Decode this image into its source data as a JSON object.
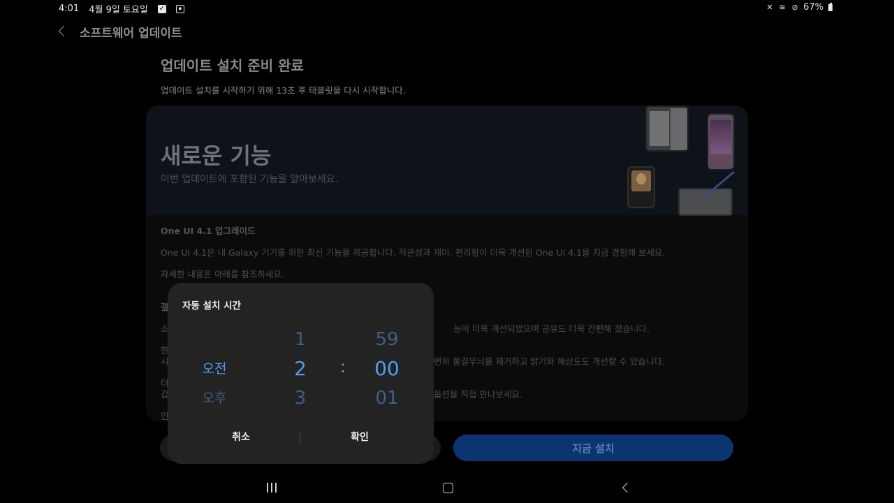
{
  "status_bar": {
    "time": "4:01",
    "date": "4월 9일 토요일",
    "battery": "67%",
    "icons": [
      "check-icon",
      "screenshot-icon",
      "mute-icon",
      "wifi-icon",
      "block-icon",
      "battery-icon"
    ]
  },
  "header": {
    "title": "소프트웨어 업데이트"
  },
  "update": {
    "title": "업데이트 설치 준비 완료",
    "description": "업데이트 설치를 시작하기 위해 13초 후 태블릿을 다시 시작합니다."
  },
  "banner": {
    "title": "새로운 기능",
    "subtitle": "이번 업데이트에 포함된 기능을 알아보세요."
  },
  "notes": {
    "heading": "One UI 4.1 업그레이드",
    "intro": "One UI 4.1은 내 Galaxy 기기를 위한 최신 기능을 제공합니다. 직관성과 재미, 편리함이 더욱 개선된 One UI 4.1을 지금 경험해 보세요.",
    "more": "자세한 내용은 아래를 참조하세요.",
    "partial_1": "갤",
    "partial_2_a": "소",
    "partial_2_b": "능이 더욱 개선되었으며 공유도 더욱 간편해 졌습니다.",
    "partial_3_a": "한",
    "partial_3_b": "시",
    "partial_3_c": "면의 물결무늬를 제거하고 밝기와 해상도도 개선할 수 있습니다.",
    "partial_4_a": "더",
    "partial_4_b": "갑",
    "partial_4_c": "옵션을 직접 만나보세요.",
    "partial_5": "인"
  },
  "buttons": {
    "install_now": "지금 설치"
  },
  "dialog": {
    "title": "자동 설치 시간",
    "ampm": {
      "selected": "오전",
      "next": "오후"
    },
    "hour": {
      "prev": "1",
      "selected": "2",
      "next": "3"
    },
    "separator": ":",
    "minute": {
      "prev": "59",
      "selected": "00",
      "next": "01"
    },
    "cancel": "취소",
    "confirm": "확인"
  },
  "colors": {
    "accent": "#4f9cf0",
    "install_button": "#0c3470",
    "dialog_bg": "#232323"
  }
}
